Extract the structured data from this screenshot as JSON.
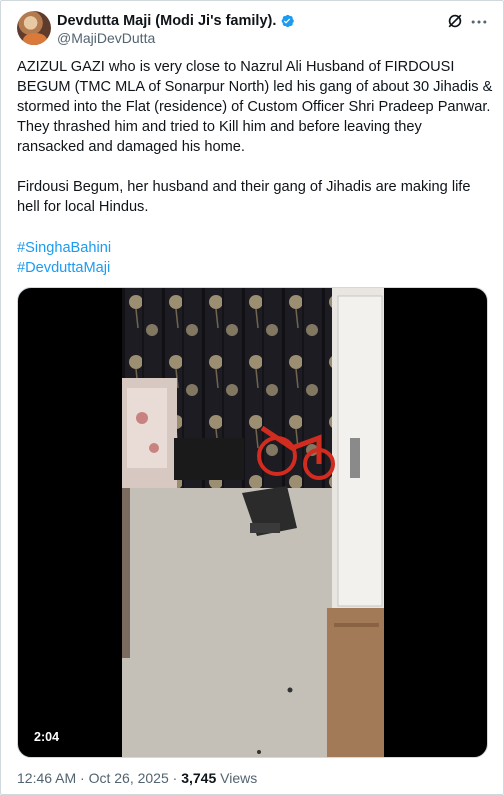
{
  "author": {
    "display_name": "Devdutta Maji (Modi Ji's family).",
    "handle": "@MajiDevDutta"
  },
  "tweet": {
    "paragraphs": [
      "AZIZUL GAZI who is very close to Nazrul Ali Husband of FIRDOUSI BEGUM (TMC MLA of Sonarpur North) led his gang of about 30 Jihadis & stormed into the Flat (residence) of Custom Officer Shri Pradeep Panwar. They thrashed him and tried to Kill him and before leaving they ransacked and damaged his home.",
      "Firdousi Begum, her husband and their gang of Jihadis are making life hell for local Hindus."
    ],
    "hashtags": [
      "#SinghaBahini",
      "#DevduttaMaji"
    ]
  },
  "video": {
    "duration": "2:04"
  },
  "meta": {
    "timestamp": "12:46 AM · Oct 26, 2025",
    "separator": " · ",
    "views_count": "3,745",
    "views_label": "Views"
  },
  "colors": {
    "link": "#1d9bf0",
    "secondary_text": "#536471",
    "verified": "#1d9bf0"
  },
  "icons": [
    "verified-badge-icon",
    "grok-icon",
    "more-options-icon"
  ]
}
